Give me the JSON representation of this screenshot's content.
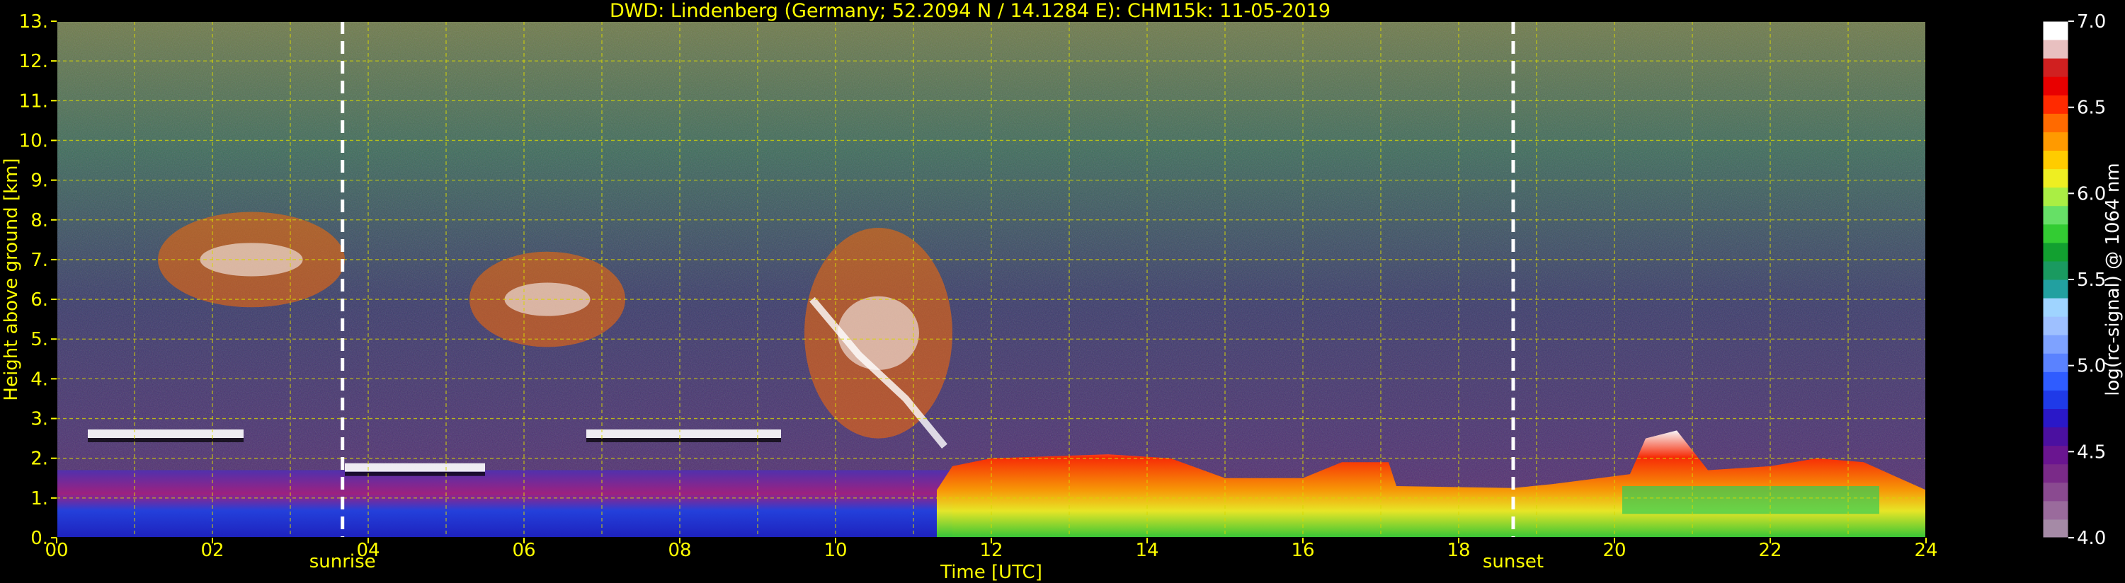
{
  "chart_data": {
    "type": "heatmap",
    "title": "DWD: Lindenberg (Germany; 52.2094 N / 14.1284 E):    CHM15k: 11-05-2019",
    "xlabel": "Time [UTC]",
    "ylabel": "Height above ground [km]",
    "xlim": [
      0,
      24
    ],
    "ylim": [
      0,
      13
    ],
    "x_ticks": [
      "00",
      "02",
      "04",
      "06",
      "08",
      "10",
      "12",
      "14",
      "16",
      "18",
      "20",
      "22",
      "24"
    ],
    "y_ticks": [
      "0.",
      "1.",
      "2.",
      "3.",
      "4.",
      "5.",
      "6.",
      "7.",
      "8.",
      "9.",
      "10.",
      "11.",
      "12.",
      "13."
    ],
    "grid": true,
    "markers": [
      {
        "label": "sunrise",
        "time_h": 3.67
      },
      {
        "label": "sunset",
        "time_h": 18.7
      }
    ],
    "colorbar": {
      "label": "log(rc-signal) @ 1064 nm",
      "range": [
        4.0,
        7.0
      ],
      "ticks": [
        "4.0",
        "4.5",
        "5.0",
        "5.5",
        "6.0",
        "6.5",
        "7.0"
      ],
      "colors": [
        "#a58aa6",
        "#9a6b9c",
        "#8a4a90",
        "#7a2a88",
        "#6a1590",
        "#4b10a0",
        "#2a18c8",
        "#1f3ae8",
        "#2f5cff",
        "#5a82ff",
        "#7ea2ff",
        "#9ec0ff",
        "#9fd4ff",
        "#22a0a0",
        "#1a9a60",
        "#12a030",
        "#33cc33",
        "#66e066",
        "#aaee44",
        "#eeee22",
        "#ffcc00",
        "#ff9a00",
        "#ff6a00",
        "#ff2a00",
        "#e80000",
        "#d02020",
        "#e8c0c0",
        "#ffffff"
      ]
    },
    "layers": {
      "aerosol_boundary_layer": {
        "night_top_km": 1.7,
        "day_top_km": 2.1,
        "evening_top_km": 1.4
      },
      "cirrus_bands": [
        {
          "t_start": 1.3,
          "t_end": 3.7,
          "base_km": 5.8,
          "top_km": 8.2
        },
        {
          "t_start": 5.3,
          "t_end": 7.3,
          "base_km": 4.8,
          "top_km": 7.2
        },
        {
          "t_start": 9.6,
          "t_end": 11.5,
          "base_km": 2.5,
          "top_km": 7.8
        }
      ],
      "low_clouds": [
        {
          "t_start": 0.4,
          "t_end": 2.4,
          "height_km": 2.6
        },
        {
          "t_start": 6.8,
          "t_end": 9.3,
          "height_km": 2.6
        },
        {
          "t_start": 3.7,
          "t_end": 5.5,
          "height_km": 1.75
        }
      ]
    }
  }
}
